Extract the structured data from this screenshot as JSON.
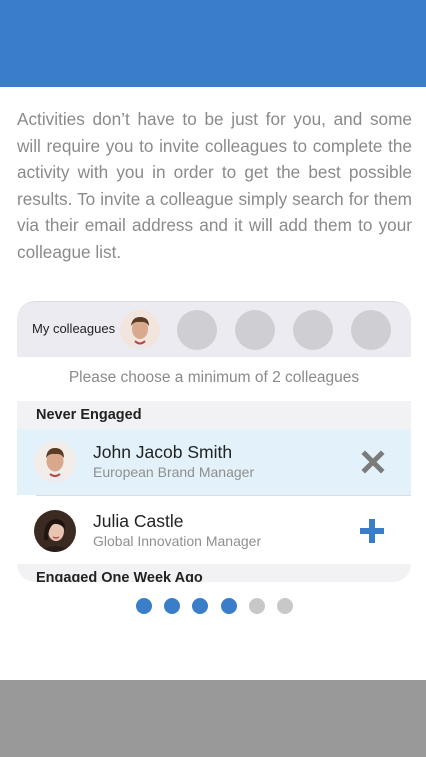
{
  "intro_text": "Activities don’t have to be just for you, and some will require you to invite colleagues to complete the activity with you in order to get the best possible results. To invite a colleague simply search for them via their email address and it will add them to your colleague list.",
  "colleagues_bar": {
    "label": "My colleagues",
    "selected_count": 1,
    "slots_total": 5
  },
  "hint": "Please choose a minimum of 2 colleagues",
  "sections": [
    {
      "title": "Never Engaged",
      "rows": [
        {
          "name": "John Jacob Smith",
          "role": "European Brand Manager",
          "action": "remove",
          "action_icon": "close-icon",
          "selected": true
        },
        {
          "name": "Julia Castle",
          "role": "Global Innovation Manager",
          "action": "add",
          "action_icon": "plus-icon",
          "selected": false
        }
      ]
    },
    {
      "title": "Engaged One Week Ago",
      "rows": []
    }
  ],
  "pager": {
    "total": 6,
    "active_count": 4
  },
  "colors": {
    "brand_blue": "#3a7dc9",
    "inactive_dot": "#c8c8c8",
    "remove_grey": "#7b7b7b"
  }
}
